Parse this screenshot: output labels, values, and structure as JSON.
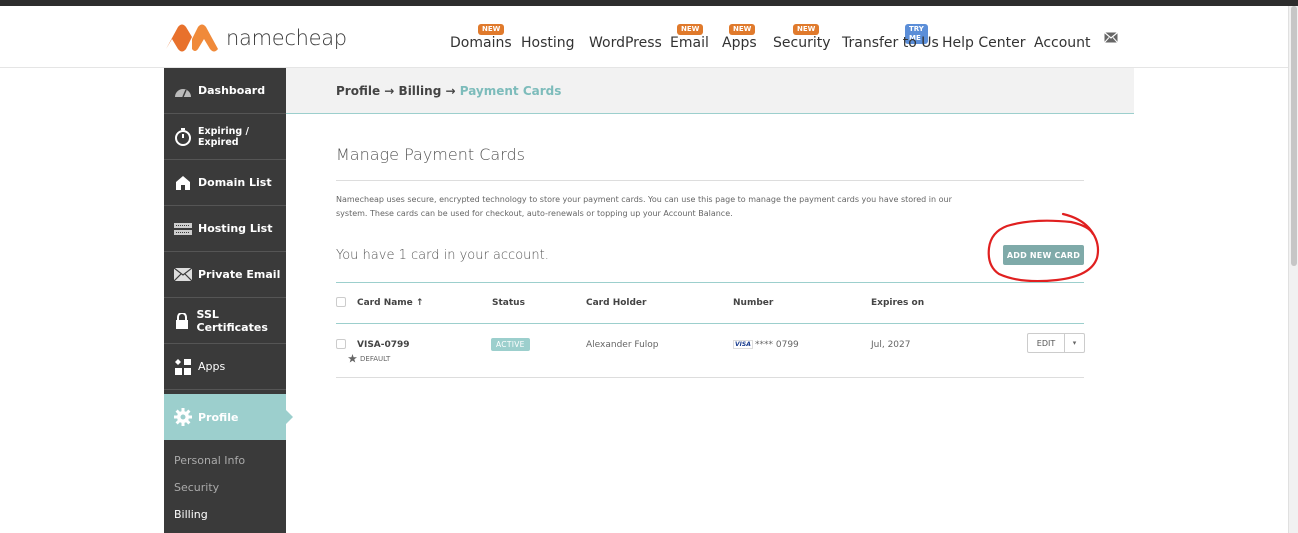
{
  "brand": {
    "name": "namecheap"
  },
  "nav": {
    "items": [
      {
        "label": "Domains",
        "badge": "NEW"
      },
      {
        "label": "Hosting",
        "badge": ""
      },
      {
        "label": "WordPress",
        "badge": ""
      },
      {
        "label": "Email",
        "badge": "NEW"
      },
      {
        "label": "Apps",
        "badge": "NEW"
      },
      {
        "label": "Security",
        "badge": "NEW"
      },
      {
        "label": "Transfer to Us",
        "badge": "TRY ME"
      },
      {
        "label": "Help Center",
        "badge": ""
      },
      {
        "label": "Account",
        "badge": ""
      }
    ],
    "mail_icon": "envelope-icon"
  },
  "sidebar": {
    "items": [
      {
        "label": "Dashboard",
        "icon": "speedometer-icon"
      },
      {
        "label": "Expiring / Expired",
        "icon": "timer-icon"
      },
      {
        "label": "Domain List",
        "icon": "house-icon"
      },
      {
        "label": "Hosting List",
        "icon": "server-icon"
      },
      {
        "label": "Private Email",
        "icon": "envelope-icon"
      },
      {
        "label": "SSL Certificates",
        "icon": "lock-icon"
      },
      {
        "label": "Apps",
        "icon": "apps-icon"
      },
      {
        "label": "Profile",
        "icon": "gear-icon"
      }
    ],
    "sub_items": [
      "Personal Info",
      "Security",
      "Billing"
    ]
  },
  "breadcrumb": {
    "part1": "Profile",
    "part2": "Billing",
    "current": "Payment Cards",
    "separator": "→"
  },
  "main": {
    "title": "Manage Payment Cards",
    "description": "Namecheap uses secure, encrypted technology to store your payment cards. You can use this page to manage the payment cards you have stored in our system. These cards can be used for checkout, auto-renewals or topping up your Account Balance.",
    "count_text": "You have 1 card in your account.",
    "add_button": "ADD NEW CARD"
  },
  "table": {
    "headers": {
      "card_name": "Card Name ↑",
      "status": "Status",
      "card_holder": "Card Holder",
      "number": "Number",
      "expires": "Expires on"
    },
    "rows": [
      {
        "card_name": "VISA-0799",
        "default_label": "DEFAULT",
        "status": "ACTIVE",
        "card_holder": "Alexander Fulop",
        "brand": "VISA",
        "number": "**** 0799",
        "expires": "Jul, 2027",
        "edit_label": "EDIT",
        "caret": "▾"
      }
    ]
  },
  "colors": {
    "accent": "#9ccfcd",
    "sidebar_bg": "#3a3a3a",
    "logo_orange": "#e8712c",
    "annotation_red": "#e02020"
  }
}
